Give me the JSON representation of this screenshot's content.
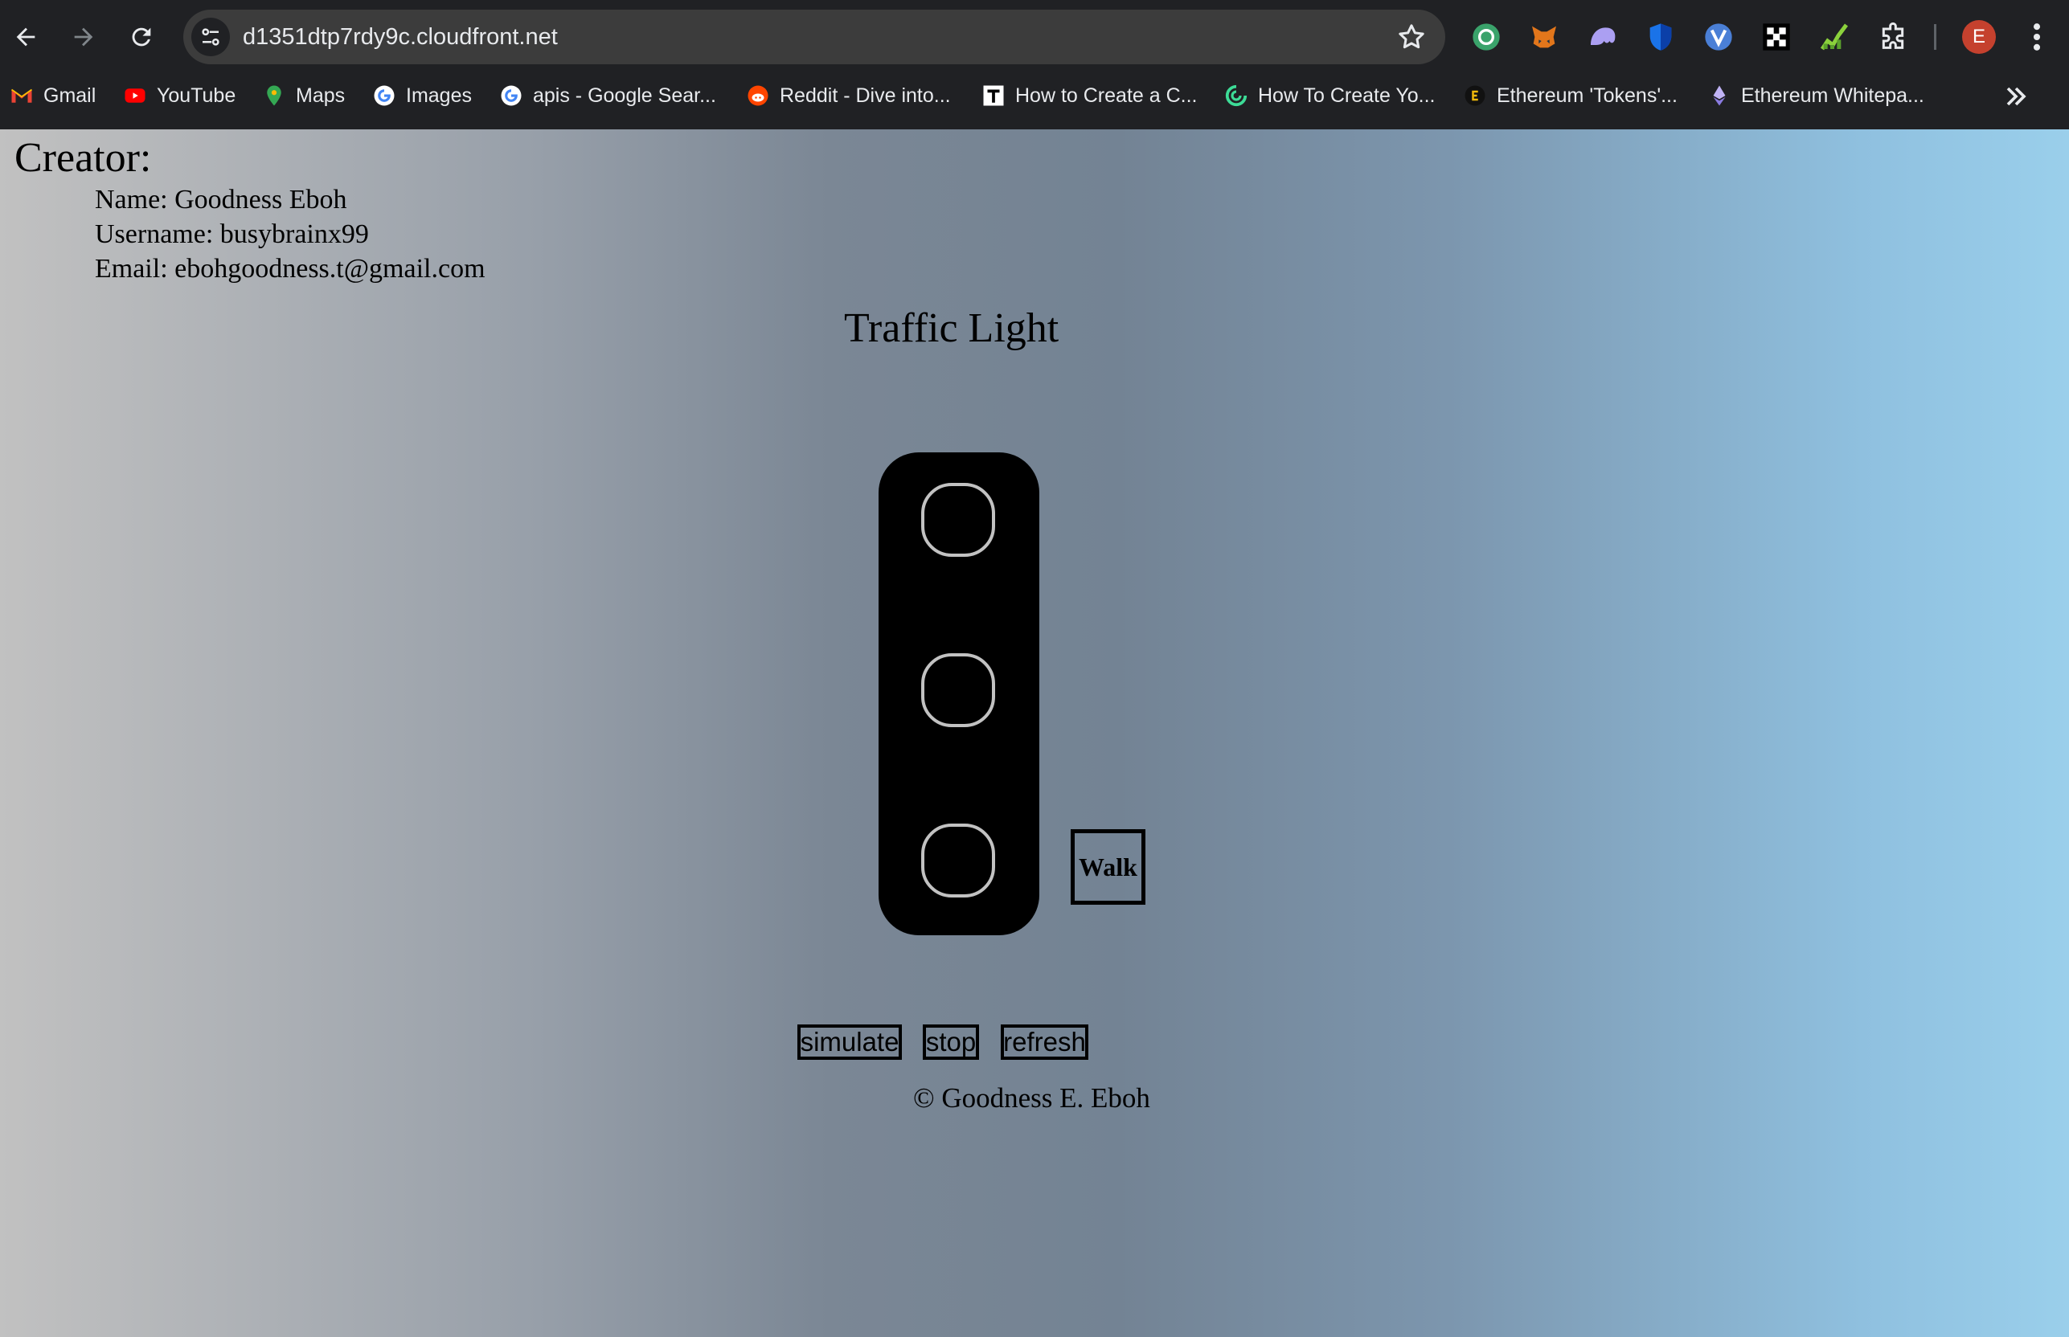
{
  "browser": {
    "url": "d1351dtp7rdy9c.cloudfront.net",
    "profile_initial": "E",
    "extension_icons": [
      "chatgpt-extension-icon",
      "metamask-fox-icon",
      "purple-ghost-extension-icon",
      "shield-extension-icon",
      "v-extension-icon",
      "checker-pattern-extension-icon",
      "chart-growth-extension-icon",
      "puzzle-extensions-icon"
    ],
    "bookmarks": [
      {
        "label": "Gmail",
        "icon": "gmail-icon"
      },
      {
        "label": "YouTube",
        "icon": "youtube-icon"
      },
      {
        "label": "Maps",
        "icon": "maps-pin-icon"
      },
      {
        "label": "Images",
        "icon": "google-icon"
      },
      {
        "label": "apis - Google Sear...",
        "icon": "google-icon"
      },
      {
        "label": "Reddit - Dive into...",
        "icon": "reddit-icon"
      },
      {
        "label": "How to Create a C...",
        "icon": "t-logo-icon"
      },
      {
        "label": "How To Create Yo...",
        "icon": "green-swirl-icon"
      },
      {
        "label": "Ethereum 'Tokens'...",
        "icon": "e-logo-icon"
      },
      {
        "label": "Ethereum Whitepa...",
        "icon": "ethereum-icon"
      }
    ]
  },
  "creator": {
    "heading": "Creator:",
    "name": "Name: Goodness Eboh",
    "username": "Username: busybrainx99",
    "email": "Email: ebohgoodness.t@gmail.com"
  },
  "title": "Traffic Light",
  "walk_label": "Walk",
  "controls": {
    "simulate": "simulate",
    "stop": "stop",
    "refresh": "refresh"
  },
  "footer": "© Goodness E. Eboh",
  "colors": {
    "chrome_bg": "#202124",
    "omnibox_bg": "#3c3c3c",
    "light_housing": "#000000",
    "lamp_outline": "#c2c2c2"
  }
}
